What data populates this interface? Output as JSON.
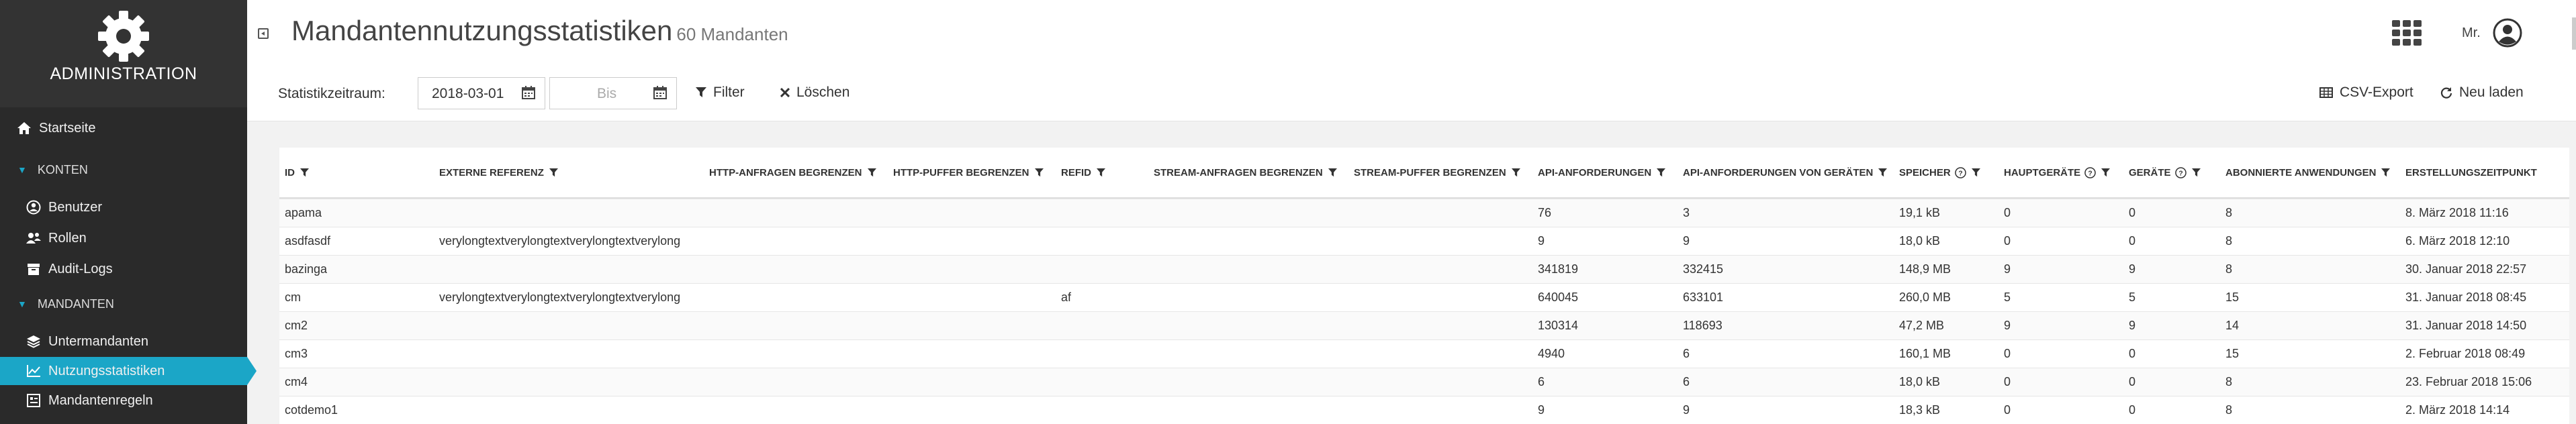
{
  "sidebar": {
    "brand_title": "ADMINISTRATION",
    "items": [
      {
        "label": "Startseite",
        "icon": "home-icon"
      },
      {
        "section": "KONTEN"
      },
      {
        "label": "Benutzer",
        "icon": "user-icon"
      },
      {
        "label": "Rollen",
        "icon": "users-icon"
      },
      {
        "label": "Audit-Logs",
        "icon": "archive-icon"
      },
      {
        "section": "MANDANTEN"
      },
      {
        "label": "Untermandanten",
        "icon": "layers-icon"
      },
      {
        "label": "Nutzungsstatistiken",
        "icon": "chart-icon",
        "active": true
      },
      {
        "label": "Mandantenregeln",
        "icon": "rules-icon"
      }
    ]
  },
  "header": {
    "title": "Mandantennutzungsstatistiken",
    "subtitle": "60 Mandanten",
    "user": "Mr."
  },
  "toolbar": {
    "label": "Statistikzeitraum:",
    "from_value": "2018-03-01",
    "to_placeholder": "Bis",
    "filter": "Filter",
    "clear": "Löschen",
    "csv": "CSV-Export",
    "reload": "Neu laden"
  },
  "table": {
    "columns": [
      {
        "label": "ID",
        "filter": true
      },
      {
        "label": "EXTERNE REFERENZ",
        "filter": true
      },
      {
        "label": "HTTP-ANFRAGEN BEGRENZEN",
        "filter": true
      },
      {
        "label": "HTTP-PUFFER BEGRENZEN",
        "filter": true
      },
      {
        "label": "REFID",
        "filter": true
      },
      {
        "label": "STREAM-ANFRAGEN BEGRENZEN",
        "filter": true
      },
      {
        "label": "STREAM-PUFFER BEGRENZEN",
        "filter": true
      },
      {
        "label": "API-ANFORDERUNGEN",
        "filter": true
      },
      {
        "label": "API-ANFORDERUNGEN VON GERÄTEN",
        "filter": true
      },
      {
        "label": "SPEICHER",
        "filter": true,
        "help": true
      },
      {
        "label": "HAUPTGERÄTE",
        "filter": true,
        "help": true
      },
      {
        "label": "GERÄTE",
        "filter": true,
        "help": true
      },
      {
        "label": "ABONNIERTE ANWENDUNGEN",
        "filter": true
      },
      {
        "label": "ERSTELLUNGSZEITPUNKT",
        "filter": false
      }
    ],
    "rows": [
      [
        "apama",
        "",
        "",
        "",
        "",
        "",
        "",
        "76",
        "3",
        "19,1 kB",
        "0",
        "0",
        "8",
        "8. März 2018 11:16"
      ],
      [
        "asdfasdf",
        "verylongtextverylongtextverylongtextverylong",
        "",
        "",
        "",
        "",
        "",
        "9",
        "9",
        "18,0 kB",
        "0",
        "0",
        "8",
        "6. März 2018 12:10"
      ],
      [
        "bazinga",
        "",
        "",
        "",
        "",
        "",
        "",
        "341819",
        "332415",
        "148,9 MB",
        "9",
        "9",
        "8",
        "30. Januar 2018 22:57"
      ],
      [
        "cm",
        "verylongtextverylongtextverylongtextverylong",
        "",
        "",
        "af",
        "",
        "",
        "640045",
        "633101",
        "260,0 MB",
        "5",
        "5",
        "15",
        "31. Januar 2018 08:45"
      ],
      [
        "cm2",
        "",
        "",
        "",
        "",
        "",
        "",
        "130314",
        "118693",
        "47,2 MB",
        "9",
        "9",
        "14",
        "31. Januar 2018 14:50"
      ],
      [
        "cm3",
        "",
        "",
        "",
        "",
        "",
        "",
        "4940",
        "6",
        "160,1 MB",
        "0",
        "0",
        "15",
        "2. Februar 2018 08:49"
      ],
      [
        "cm4",
        "",
        "",
        "",
        "",
        "",
        "",
        "6",
        "6",
        "18,0 kB",
        "0",
        "0",
        "8",
        "23. Februar 2018 15:06"
      ],
      [
        "cotdemo1",
        "",
        "",
        "",
        "",
        "",
        "",
        "9",
        "9",
        "18,3 kB",
        "0",
        "0",
        "8",
        "2. März 2018 14:14"
      ]
    ]
  },
  "colors": {
    "sidebar_bg": "#2a2a2a",
    "accent": "#1ba6c7"
  }
}
